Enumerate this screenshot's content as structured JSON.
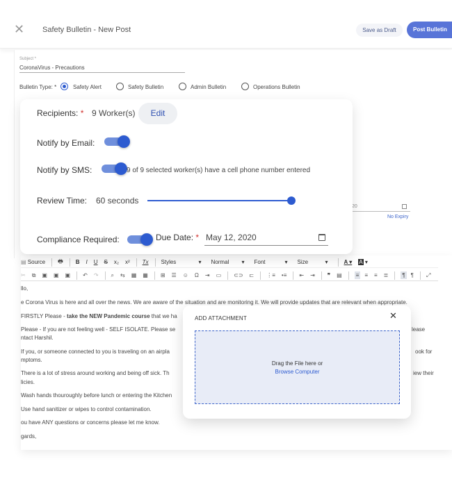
{
  "window": {
    "title": "Safety Bulletin - New Post",
    "close_icon": "close-icon",
    "save_draft_label": "Save as Draft",
    "post_label": "Post Bulletin"
  },
  "form": {
    "subject_label": "Subject *",
    "subject_value": "CoronaVirus - Precautions",
    "bulletin_type_label": "Bulletin Type: *",
    "bulletin_types": [
      "Safety Alert",
      "Safety Bulletin",
      "Admin Bulletin",
      "Operations Bulletin"
    ],
    "bulletin_type_selected": "Safety Alert",
    "side_date_fragment": "20",
    "no_expiry": "No Expiry"
  },
  "settings": {
    "recipients_label": "Recipients:",
    "required_mark": "*",
    "recipients_value": "9 Worker(s)",
    "edit_label": "Edit",
    "notify_email_label": "Notify by Email:",
    "notify_email_on": true,
    "notify_sms_label": "Notify by SMS:",
    "notify_sms_on": true,
    "sms_note": "9 of 9 selected worker(s) have a cell phone number entered",
    "review_time_label": "Review Time:",
    "review_time_value": "60 seconds",
    "compliance_label": "Compliance Required:",
    "compliance_on": true,
    "due_date_label": "Due Date:",
    "due_date_value": "May 12, 2020"
  },
  "toolbar": {
    "source": "Source",
    "bold": "B",
    "italic": "I",
    "underline": "U",
    "strike": "S",
    "subscript": "x₂",
    "superscript": "x²",
    "clear_format": "Tx",
    "styles": "Styles",
    "format": "Normal",
    "font": "Font",
    "size": "Size",
    "text_color": "A",
    "bg_color": "A"
  },
  "editor": {
    "lines": [
      "llo,",
      "e Corona Virus is here and all over the news.  We are aware of the situation and are monitoring it.  We will provide updates that are relevant when appropriate.",
      "FIRSTLY Please - ",
      "take the NEW Pandemic course",
      " that we ha",
      "Please - If you are not feeling well - SELF ISOLATE.  Please se",
      "lease",
      "ntact Harshil.",
      "If you, or someone connected to you is traveling on an airpla",
      "ook for",
      "mptoms.",
      "There is a lot of stress around working and being off sick.  Th",
      "iew their",
      "licies.",
      "Wash hands thouroughly before lunch or entering the Kitchen",
      "Use hand sanitizer or wipes to control contamination.",
      "ou have ANY questions or concerns please let me know.",
      "gards,"
    ]
  },
  "attachment": {
    "title": "ADD ATTACHMENT",
    "drag_text": "Drag the File here or",
    "browse_label": "Browse Computer"
  },
  "colors": {
    "accent": "#2d5bd0",
    "required": "#d0312d",
    "dropzone": "#e8ecf7"
  }
}
